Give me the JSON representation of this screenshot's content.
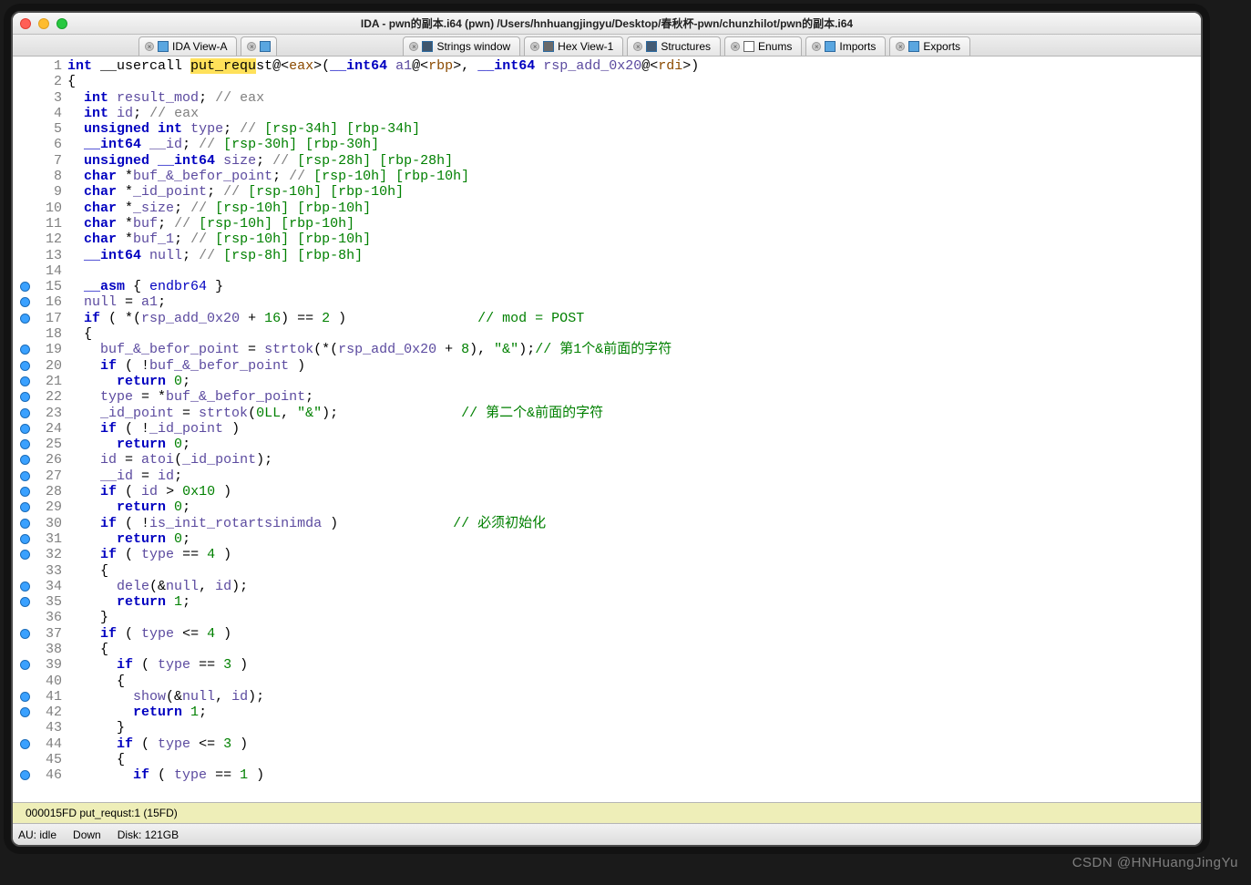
{
  "window": {
    "title": "IDA - pwn的副本.i64 (pwn) /Users/hnhuangjingyu/Desktop/春秋杯-pwn/chunzhilot/pwn的副本.i64"
  },
  "tabs": [
    {
      "label": "IDA View-A",
      "icon": "view"
    },
    {
      "label": "",
      "icon": "pseudo"
    },
    {
      "label": "Strings window",
      "icon": "strings"
    },
    {
      "label": "Hex View-1",
      "icon": "hex"
    },
    {
      "label": "Structures",
      "icon": "struct"
    },
    {
      "label": "Enums",
      "icon": "enum"
    },
    {
      "label": "Imports",
      "icon": "imports"
    },
    {
      "label": "Exports",
      "icon": "exports"
    }
  ],
  "lines": [
    {
      "n": 1,
      "bp": false
    },
    {
      "n": 2,
      "bp": false
    },
    {
      "n": 3,
      "bp": false
    },
    {
      "n": 4,
      "bp": false
    },
    {
      "n": 5,
      "bp": false
    },
    {
      "n": 6,
      "bp": false
    },
    {
      "n": 7,
      "bp": false
    },
    {
      "n": 8,
      "bp": false
    },
    {
      "n": 9,
      "bp": false
    },
    {
      "n": 10,
      "bp": false
    },
    {
      "n": 11,
      "bp": false
    },
    {
      "n": 12,
      "bp": false
    },
    {
      "n": 13,
      "bp": false
    },
    {
      "n": 14,
      "bp": false
    },
    {
      "n": 15,
      "bp": true
    },
    {
      "n": 16,
      "bp": true
    },
    {
      "n": 17,
      "bp": true
    },
    {
      "n": 18,
      "bp": false
    },
    {
      "n": 19,
      "bp": true
    },
    {
      "n": 20,
      "bp": true
    },
    {
      "n": 21,
      "bp": true
    },
    {
      "n": 22,
      "bp": true
    },
    {
      "n": 23,
      "bp": true
    },
    {
      "n": 24,
      "bp": true
    },
    {
      "n": 25,
      "bp": true
    },
    {
      "n": 26,
      "bp": true
    },
    {
      "n": 27,
      "bp": true
    },
    {
      "n": 28,
      "bp": true
    },
    {
      "n": 29,
      "bp": true
    },
    {
      "n": 30,
      "bp": true
    },
    {
      "n": 31,
      "bp": true
    },
    {
      "n": 32,
      "bp": true
    },
    {
      "n": 33,
      "bp": false
    },
    {
      "n": 34,
      "bp": true
    },
    {
      "n": 35,
      "bp": true
    },
    {
      "n": 36,
      "bp": false
    },
    {
      "n": 37,
      "bp": true
    },
    {
      "n": 38,
      "bp": false
    },
    {
      "n": 39,
      "bp": true
    },
    {
      "n": 40,
      "bp": false
    },
    {
      "n": 41,
      "bp": true
    },
    {
      "n": 42,
      "bp": true
    },
    {
      "n": 43,
      "bp": false
    },
    {
      "n": 44,
      "bp": true
    },
    {
      "n": 45,
      "bp": false
    },
    {
      "n": 46,
      "bp": true
    }
  ],
  "code_html": "<span class='kw'>int</span> __usercall <span class='hl'>put_requ</span>st@&lt;<span class='brown'>eax</span>&gt;(<span class='kw'>__int64</span> <span class='id'>a1</span>@&lt;<span class='brown'>rbp</span>&gt;, <span class='kw'>__int64</span> <span class='id'>rsp_add_0x20</span>@&lt;<span class='brown'>rdi</span>&gt;)\n{\n  <span class='kw'>int</span> <span class='id'>result_mod</span>; <span class='cm'>// eax</span>\n  <span class='kw'>int</span> <span class='id'>id</span>; <span class='cm'>// eax</span>\n  <span class='kw'>unsigned int</span> <span class='id'>type</span>; <span class='cm'>//</span> <span class='reg'>[rsp-34h] [rbp-34h]</span>\n  <span class='kw'>__int64</span> <span class='id'>__id</span>; <span class='cm'>//</span> <span class='reg'>[rsp-30h] [rbp-30h]</span>\n  <span class='kw'>unsigned __int64</span> <span class='id'>size</span>; <span class='cm'>//</span> <span class='reg'>[rsp-28h] [rbp-28h]</span>\n  <span class='kw'>char</span> *<span class='id'>buf_&_befor_point</span>; <span class='cm'>//</span> <span class='reg'>[rsp-10h] [rbp-10h]</span>\n  <span class='kw'>char</span> *<span class='id'>_id_point</span>; <span class='cm'>//</span> <span class='reg'>[rsp-10h] [rbp-10h]</span>\n  <span class='kw'>char</span> *<span class='id'>_size</span>; <span class='cm'>//</span> <span class='reg'>[rsp-10h] [rbp-10h]</span>\n  <span class='kw'>char</span> *<span class='id'>buf</span>; <span class='cm'>//</span> <span class='reg'>[rsp-10h] [rbp-10h]</span>\n  <span class='kw'>char</span> *<span class='id'>buf_1</span>; <span class='cm'>//</span> <span class='reg'>[rsp-10h] [rbp-10h]</span>\n  <span class='kw'>__int64</span> <span class='id'>null</span>; <span class='cm'>//</span> <span class='reg'>[rsp-8h] [rbp-8h]</span>\n\n  <span class='kw'>__asm</span> { <span class='navy'>endbr64</span> }\n  <span class='id'>null</span> = <span class='id'>a1</span>;\n  <span class='kw'>if</span> ( *(<span class='id'>rsp_add_0x20</span> + <span class='num'>16</span>) == <span class='num'>2</span> )                <span class='reg'>// mod = POST</span>\n  {\n    <span class='id'>buf_&_befor_point</span> = <span class='fn'>strtok</span>(*(<span class='id'>rsp_add_0x20</span> + <span class='num'>8</span>), <span class='str'>\"&amp;\"</span>);<span class='reg'>// 第1个&前面的字符</span>\n    <span class='kw'>if</span> ( !<span class='id'>buf_&_befor_point</span> )\n      <span class='kw'>return</span> <span class='num'>0</span>;\n    <span class='id'>type</span> = *<span class='id'>buf_&_befor_point</span>;\n    <span class='id'>_id_point</span> = <span class='fn'>strtok</span>(<span class='num'>0LL</span>, <span class='str'>\"&amp;\"</span>);               <span class='reg'>// 第二个&前面的字符</span>\n    <span class='kw'>if</span> ( !<span class='id'>_id_point</span> )\n      <span class='kw'>return</span> <span class='num'>0</span>;\n    <span class='id'>id</span> = <span class='fn'>atoi</span>(<span class='id'>_id_point</span>);\n    <span class='id'>__id</span> = <span class='id'>id</span>;\n    <span class='kw'>if</span> ( <span class='id'>id</span> &gt; <span class='num'>0x10</span> )\n      <span class='kw'>return</span> <span class='num'>0</span>;\n    <span class='kw'>if</span> ( !<span class='id'>is_init_rotartsinimda</span> )              <span class='reg'>// 必须初始化</span>\n      <span class='kw'>return</span> <span class='num'>0</span>;\n    <span class='kw'>if</span> ( <span class='id'>type</span> == <span class='num'>4</span> )\n    {\n      <span class='fn'>dele</span>(&amp;<span class='id'>null</span>, <span class='id'>id</span>);\n      <span class='kw'>return</span> <span class='num'>1</span>;\n    }\n    <span class='kw'>if</span> ( <span class='id'>type</span> &lt;= <span class='num'>4</span> )\n    {\n      <span class='kw'>if</span> ( <span class='id'>type</span> == <span class='num'>3</span> )\n      {\n        <span class='fn'>show</span>(&amp;<span class='id'>null</span>, <span class='id'>id</span>);\n        <span class='kw'>return</span> <span class='num'>1</span>;\n      }\n      <span class='kw'>if</span> ( <span class='id'>type</span> &lt;= <span class='num'>3</span> )\n      {\n        <span class='kw'>if</span> ( <span class='id'>type</span> == <span class='num'>1</span> )",
  "status": {
    "addr": "000015FD  put_requst:1 (15FD)"
  },
  "bottom": {
    "au": "AU:  idle",
    "down": "Down",
    "disk": "Disk: 121GB"
  },
  "watermark": "CSDN @HNHuangJingYu"
}
